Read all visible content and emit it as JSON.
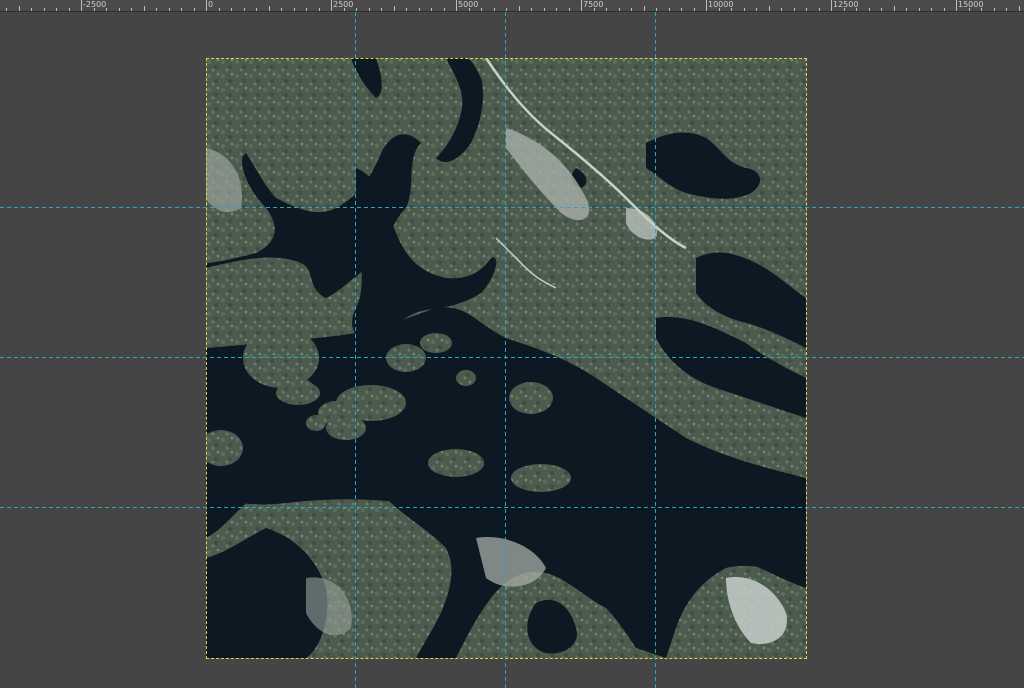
{
  "ruler": {
    "unit_labels": [
      "-2500",
      "0",
      "2500",
      "5000",
      "7500",
      "10000",
      "12500",
      "15000"
    ]
  },
  "canvas": {
    "background_color": "#454545",
    "image_description_icon": "aerial-map-layer"
  },
  "colors": {
    "water": "#0c1822",
    "forest": "#4a5a4c",
    "guide": "#2aa6c0",
    "layer_boundary": "#d8d84a"
  }
}
